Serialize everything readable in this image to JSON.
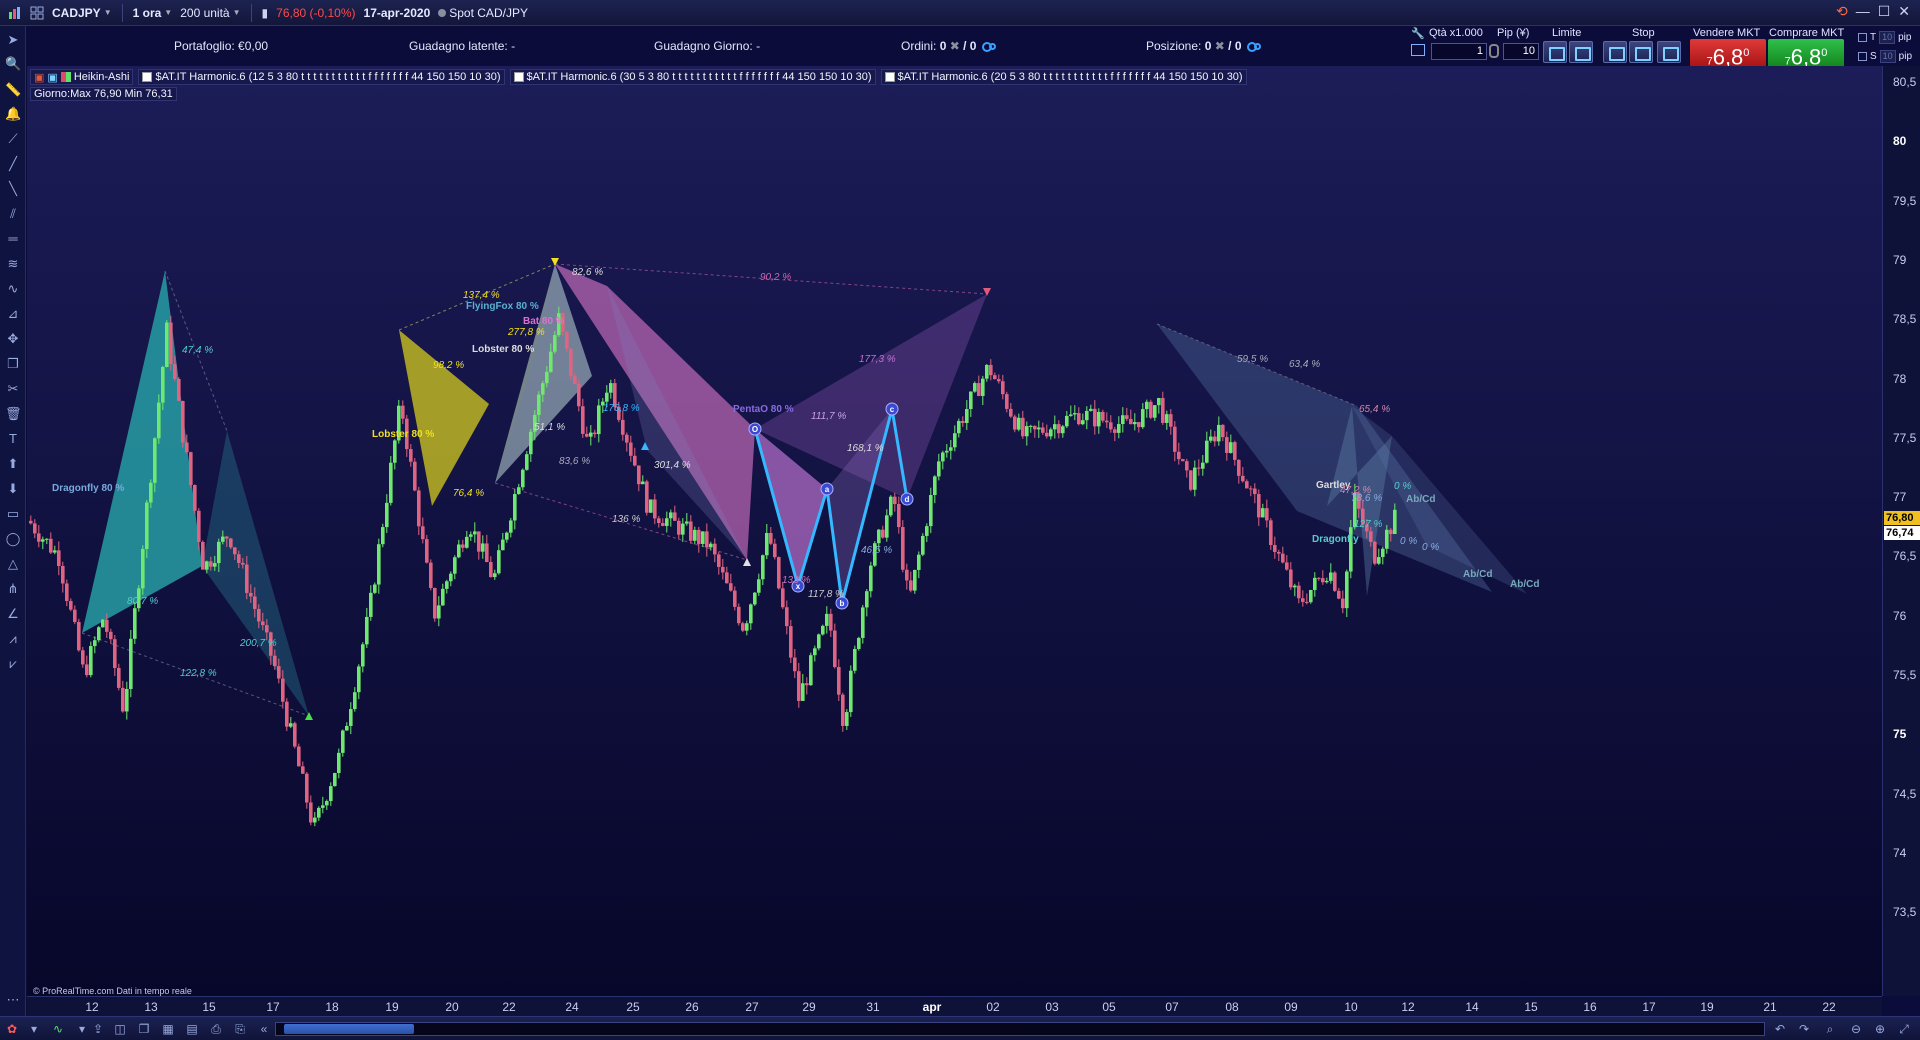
{
  "titlebar": {
    "symbol": "CADJPY",
    "timeframe": "1 ora",
    "units": "200 unità",
    "price_change": "76,80 (-0,10%)",
    "date": "17-apr-2020",
    "instrument": "Spot CAD/JPY"
  },
  "infobar": {
    "portfolio": "Portafoglio: €0,00",
    "latent_gain": "Guadagno latente: -",
    "day_gain": "Guadagno Giorno: -",
    "orders_label": "Ordini:",
    "orders_value": "0",
    "orders_second": "/ 0",
    "position_label": "Posizione:",
    "position_value": "0",
    "position_second": "/ 0"
  },
  "trade_panel": {
    "qty_label": "Qtà x1.000",
    "pip_label": "Pip (¥)",
    "limit_label": "Limite",
    "stop_label": "Stop",
    "sell_label": "Vendere MKT",
    "buy_label": "Comprare MKT",
    "qty_value": "1",
    "pip_value": "10",
    "sell_small": "7",
    "sell_price": "6,8",
    "sell_sup": "0",
    "buy_small": "7",
    "buy_price": "6,8",
    "buy_sup": "0",
    "t_label": "T",
    "s_label": "S",
    "t_value": "10",
    "s_value": "10",
    "pip_unit": "pip"
  },
  "indicators": [
    "Heikin-Ashi",
    "$AT.IT Harmonic.6 (12 5 3 80 t t t t t t t t t t t f f f f f f f 44 150 150 10 30)",
    "$AT.IT Harmonic.6 (30 5 3 80 t t t t t t t t t t t f f f f f f f 44 150 150 10 30)",
    "$AT.IT Harmonic.6 (20 5 3 80 t t t t t t t t t t t f f f f f f f 44 150 150 10 30)"
  ],
  "day_info": "Giorno:Max 76,90 Min 76,31",
  "credit": "© ProRealTime.com  Dati in tempo reale",
  "price_axis": {
    "labels": [
      "80,5",
      "80",
      "79,5",
      "79",
      "78,5",
      "78",
      "77,5",
      "77",
      "76,5",
      "76",
      "75,5",
      "75",
      "74,5",
      "74",
      "73,5"
    ],
    "current_price": "76,80",
    "secondary_price": "76,74"
  },
  "time_axis": {
    "labels": [
      "12",
      "13",
      "15",
      "17",
      "18",
      "19",
      "20",
      "22",
      "24",
      "25",
      "26",
      "27",
      "29",
      "31",
      "apr",
      "02",
      "03",
      "05",
      "07",
      "08",
      "09",
      "10",
      "12",
      "14",
      "15",
      "16",
      "17",
      "19",
      "21",
      "22"
    ]
  },
  "chart_data": {
    "type": "candlestick",
    "ylim": [
      73.2,
      80.7
    ],
    "pattern_labels": [
      "Dragonfly 80 %",
      "47,4 %",
      "80,7 %",
      "200,7 %",
      "122,8 %",
      "Lobster 80 %",
      "98,2 %",
      "76,4 %",
      "137,4 %",
      "FlyingFox 80 %",
      "Lobster 80 %",
      "277,8 %",
      "51,1 %",
      "83,6 %",
      "Bat 80 %",
      "82,6 %",
      "90,2 %",
      "176,8 %",
      "136 %",
      "301,4 %",
      "PentaO 80 %",
      "111,7 %",
      "177,3 %",
      "133 %",
      "117,8 %",
      "46,5 %",
      "168,1 %",
      "59,5 %",
      "63,4 %",
      "65,4 %",
      "Gartley",
      "47,2 %",
      "78,6 %",
      "127 %",
      "0 %",
      "0 %",
      "0 %",
      "Ab/Cd",
      "Ab/Cd",
      "Ab/Cd",
      "Dragonfly"
    ]
  }
}
